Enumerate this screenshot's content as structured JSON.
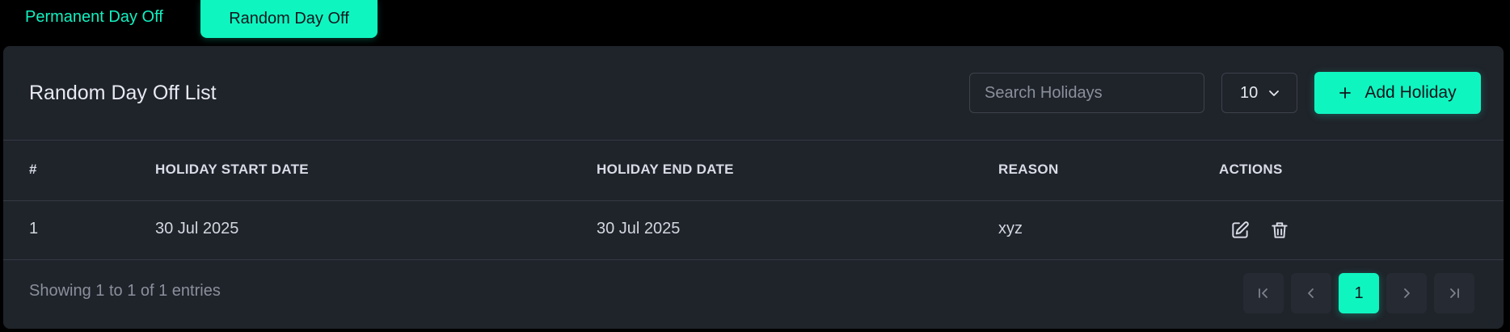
{
  "tabs": {
    "permanent_label": "Permanent Day Off",
    "random_label": "Random Day Off"
  },
  "card": {
    "title": "Random Day Off List",
    "search_placeholder": "Search Holidays",
    "page_size": "10",
    "add_button_label": "Add Holiday"
  },
  "table": {
    "columns": [
      "#",
      "HOLIDAY START DATE",
      "HOLIDAY END DATE",
      "REASON",
      "ACTIONS"
    ],
    "rows": [
      {
        "num": "1",
        "start": "30 Jul 2025",
        "end": "30 Jul 2025",
        "reason": "xyz",
        "actions": [
          "edit-icon",
          "trash-icon"
        ]
      }
    ]
  },
  "footer": {
    "entries_text": "Showing 1 to 1 of 1 entries",
    "current_page": "1"
  },
  "colors": {
    "accent": "#0ff5c0",
    "card_bg": "#1f232a",
    "page_bg": "#000000"
  }
}
